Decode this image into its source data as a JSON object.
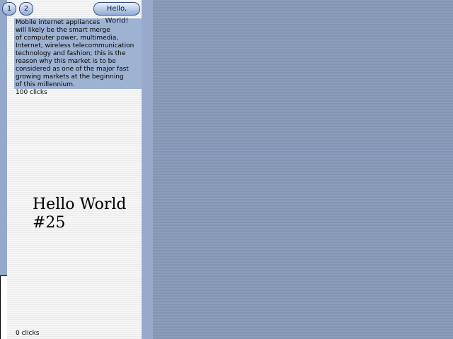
{
  "toolbar": {
    "button_1_label": "1",
    "button_2_label": "2",
    "hello_button_label": "Hello, World!"
  },
  "content": {
    "paragraph": "Mobile internet appliances\nwill likely be the smart merge\nof computer power, multimedia,\nInternet, wireless telecommunication\ntechnology and fashion; this is the\nreason why this market is to be\nconsidered as one of the major fast\ngrowing markets at the beginning\nof this millennium.",
    "top_clicks": "100 clicks",
    "title": "Hello World\n#25",
    "bottom_clicks": "0 clicks"
  },
  "colors": {
    "background": "#8799b7",
    "panel": "#f4f4f4",
    "text_box": "#9eb2d2",
    "button_border": "#2e4c7e"
  }
}
